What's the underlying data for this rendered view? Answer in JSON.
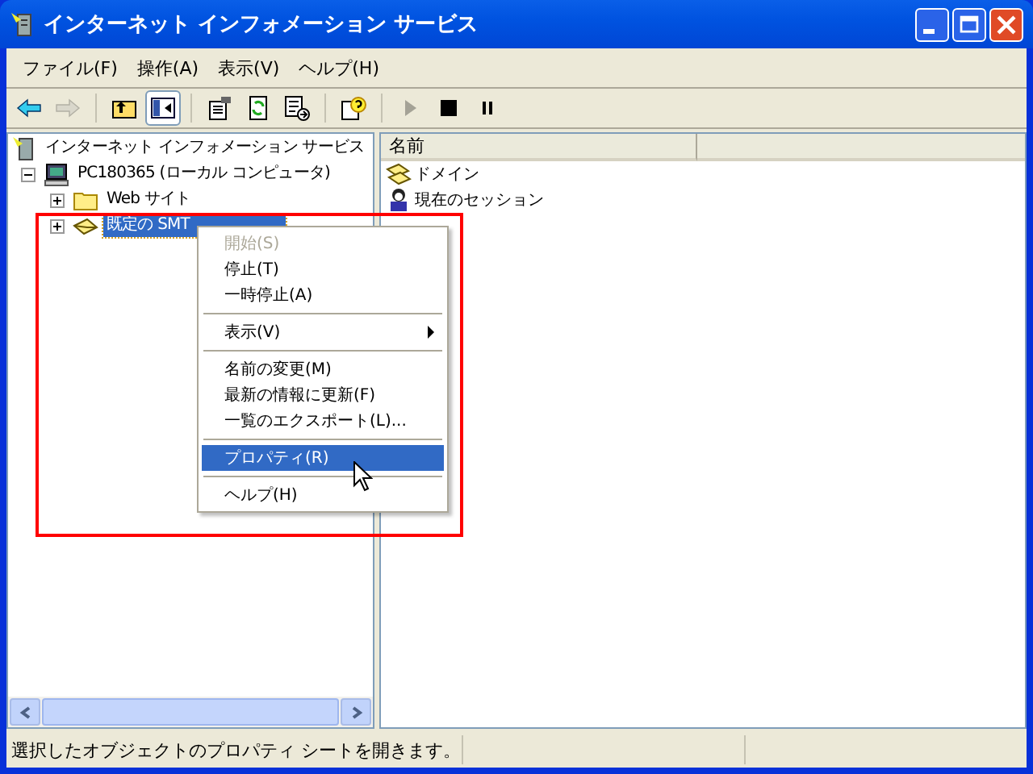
{
  "window": {
    "title": "インターネット インフォメーション サービス"
  },
  "menu_bar": [
    "ファイル(F)",
    "操作(A)",
    "表示(V)",
    "ヘルプ(H)"
  ],
  "toolbar": [
    {
      "kind": "back",
      "disabled": false,
      "pressed": false
    },
    {
      "kind": "forward",
      "disabled": true,
      "pressed": false
    },
    {
      "kind": "separator"
    },
    {
      "kind": "up",
      "disabled": false,
      "pressed": false
    },
    {
      "kind": "tree",
      "disabled": false,
      "pressed": true
    },
    {
      "kind": "separator"
    },
    {
      "kind": "properties",
      "disabled": false,
      "pressed": false
    },
    {
      "kind": "refresh",
      "disabled": false,
      "pressed": false
    },
    {
      "kind": "export",
      "disabled": false,
      "pressed": false
    },
    {
      "kind": "separator"
    },
    {
      "kind": "help",
      "disabled": false,
      "pressed": false
    },
    {
      "kind": "separator"
    },
    {
      "kind": "play",
      "disabled": true,
      "pressed": false
    },
    {
      "kind": "stop",
      "disabled": false,
      "pressed": false
    },
    {
      "kind": "pause",
      "disabled": false,
      "pressed": false
    }
  ],
  "tree": [
    {
      "label": "インターネット インフォメーション サービス",
      "kind": "server",
      "selected": false,
      "expanded": true,
      "children": [
        {
          "label": "PC180365 (ローカル コンピュータ)",
          "kind": "computer",
          "selected": false,
          "expanded": true,
          "children": [
            {
              "label": "Web サイト",
              "kind": "folder",
              "selected": false,
              "expanded": false
            },
            {
              "label": "既定の SMT",
              "kind": "mail",
              "selected": true,
              "expanded": false
            }
          ]
        }
      ]
    }
  ],
  "list": {
    "columns": [
      "名前"
    ],
    "rows": [
      {
        "name": "ドメイン",
        "kind": "domain"
      },
      {
        "name": "現在のセッション",
        "kind": "session"
      }
    ]
  },
  "context_menu": [
    {
      "kind": "item",
      "label": "開始(S)",
      "disabled": true,
      "selected": false
    },
    {
      "kind": "item",
      "label": "停止(T)",
      "disabled": false,
      "selected": false
    },
    {
      "kind": "item",
      "label": "一時停止(A)",
      "disabled": false,
      "selected": false
    },
    {
      "kind": "separator"
    },
    {
      "kind": "submenu",
      "label": "表示(V)",
      "disabled": false,
      "selected": false
    },
    {
      "kind": "separator"
    },
    {
      "kind": "item",
      "label": "名前の変更(M)",
      "disabled": false,
      "selected": false
    },
    {
      "kind": "item",
      "label": "最新の情報に更新(F)",
      "disabled": false,
      "selected": false
    },
    {
      "kind": "item",
      "label": "一覧のエクスポート(L)...",
      "disabled": false,
      "selected": false
    },
    {
      "kind": "separator"
    },
    {
      "kind": "item",
      "label": "プロパティ(R)",
      "disabled": false,
      "selected": true
    },
    {
      "kind": "separator"
    },
    {
      "kind": "item",
      "label": "ヘルプ(H)",
      "disabled": false,
      "selected": false
    }
  ],
  "status_bar": [
    "選択したオブジェクトのプロパティ シートを開きます。"
  ]
}
